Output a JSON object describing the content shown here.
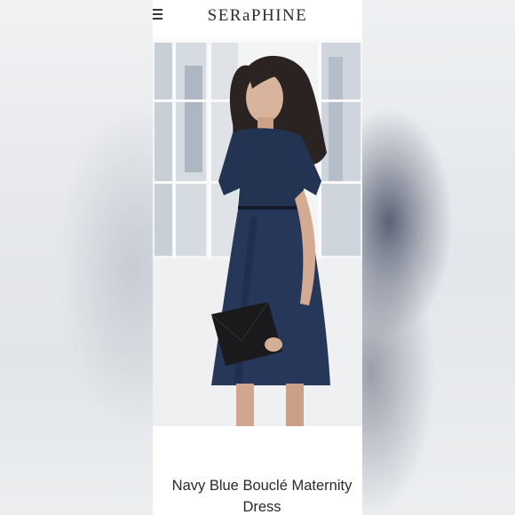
{
  "brand": {
    "logo": "SERaPHINE"
  },
  "header": {
    "menu_icon": "hamburger-menu-icon"
  },
  "product": {
    "title_line1": "Navy Blue Bouclé Maternity",
    "title_line2": "Dress"
  },
  "carousel": {
    "slides": 4,
    "active_index": 0
  },
  "colors": {
    "dress": "#233352",
    "background": "#ffffff",
    "text": "#2a2a2a"
  }
}
